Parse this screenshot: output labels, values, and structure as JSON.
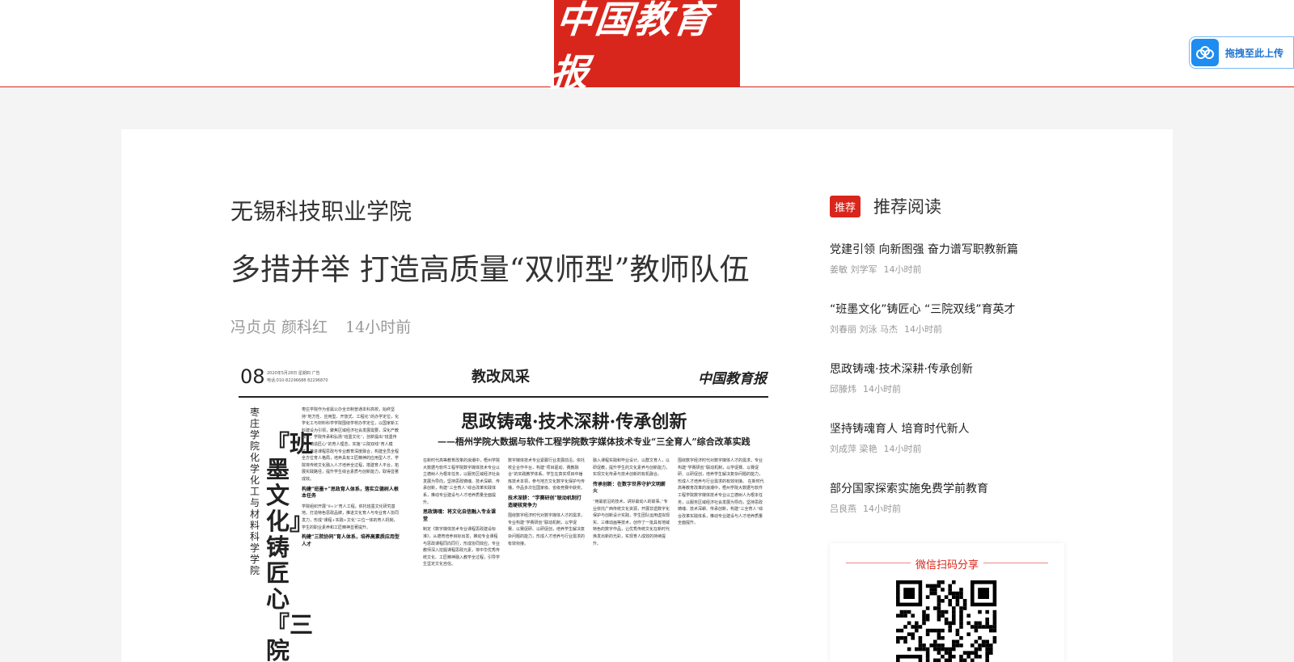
{
  "header": {
    "logo_text": "中国教育报",
    "upload_label": "拖拽至此上传",
    "brand_color": "#d9261c"
  },
  "article": {
    "school": "无锡科技职业学院",
    "headline": "多措并举 打造高质量“双师型”教师队伍",
    "authors": "冯贞贞 颜科红",
    "time": "14小时前"
  },
  "paper": {
    "page_num": "08",
    "meta_line1": "2020年5月28日 星期四 广告",
    "meta_line2": "电话:010-82296688 82296870",
    "section": "教改风采",
    "brand": "中国教育报",
    "side_school": "枣庄学院化学化工与材料科学学院",
    "side_headline": "『班墨文化』铸匠心『三院",
    "title": "思政铸魂·技术深耕·传承创新",
    "subtitle": "——梧州学院大数据与软件工程学院数字媒体技术专业“三全育人”综合改革实践",
    "col1_text": "枣庄学院作为省属公办全日制普通本科高校，始终坚持“地方性、应用型、开放式、工程化”的办学定位，化学化工与材料科学学院围绕学校办学定位，以国家新工科建设为引领，聚焦区域经济社会发展需要，深化产教融合，学院传承和弘扬“班墨文化”，创新提出“班墨传承，铸造匠心”的育人理念，实施“三院双线”育人模式，推进课程思政与专业教育深度融合，构建全员全程全方位育人格局，培养具有工匠精神的应用型人才。学院将传统文化融入人才培养全过程，搭建育人平台，拓展实践路径，提升学生综合素质与创新能力，取得显著成效。",
    "col1_head": "构建“班墨+”思政育人体系，落实立德树人根本任务",
    "col1_text2": "学院组织开展“9+3”育人工程，依托班墨文化研究基地，打造特色思政品牌，推进文化育人与专业育人协同发力，形成“课程+实践+文化”三位一体的育人机制，学生的职业素养和工匠精神显著提升。",
    "col1_head2": "构建“三院协同”育人体系，培养高素质应用型人才",
    "col2_text": "在新时代高等教育改革的浪潮中，梧州学院大数据与软件工程学院数字媒体技术专业以立德树人为根本任务，以服务区域经济社会发展为导向，坚持思政铸魂、技术深耕、传承创新，构建“三全育人”综合改革实践体系，推动专业建设与人才培养质量全面提升。",
    "col2_head": "思政铸魂：将文化自信融入专业课堂",
    "col2_text2": "制定《数字媒体技术专业课程思政建设标准》，从德育培养目标出发，推动专业课程与思政课程同向同行，形成协同效应。专业教师深入挖掘课程思政元素，将中华优秀传统文化、工匠精神融入教学全过程，引导学生坚定文化自信。",
    "col3_text": "数字媒体技术专业紧跟行业发展前沿，依托校企合作平台，构建“项目驱动、赛教融合”的实践教学体系。学生在真实项目中锤炼技术本领，参与地方文化数字化保护与传播，作品多次在国家级、省级竞赛中获奖。",
    "col3_head": "技术深耕：“学赛研创”联动机制打造硬核竞争力",
    "col3_text2": "围绕数字经济时代对数字媒体人才的需求，专业构建“学赛研创”联动机制，以学促赛、以赛促研、以研促创，培养学生解决复杂问题的能力，形成人才培养与行业需求的有效衔接。",
    "col4_text": "融入课程实践和毕业设计。以群文育人，以研促教，提升学生的文化素养与创新能力，实现文化传承与技术创新的有机融合。",
    "col4_head": "传承创新：在数字世界守护文明薪火",
    "col4_text2": "“用最前沿的技术，讲好最动人的故事。”专业依托广西传统文化资源，开展非遗数字化保护与创新设计实践，学生团队运用虚拟现实、三维动画等技术，创作了一批具有地域特色的数字作品，让优秀传统文化在新时代焕发出新的光彩，实现育人成效的持续提升。"
  },
  "recommend": {
    "badge": "推荐",
    "title": "推荐阅读",
    "items": [
      {
        "title": "党建引领 向新图强 奋力谱写职教新篇",
        "authors": "姜敏 刘学军",
        "time": "14小时前"
      },
      {
        "title": "“班墨文化”铸匠心 “三院双线”育英才",
        "authors": "刘春丽 刘泳 马杰",
        "time": "14小时前"
      },
      {
        "title": "思政铸魂·技术深耕·传承创新",
        "authors": "邱滕炜",
        "time": "14小时前"
      },
      {
        "title": "坚持铸魂育人 培育时代新人",
        "authors": "刘成萍 梁艳",
        "time": "14小时前"
      },
      {
        "title": "部分国家探索实施免费学前教育",
        "authors": "吕良燕",
        "time": "14小时前"
      }
    ]
  },
  "share": {
    "label": "微信扫码分享"
  }
}
